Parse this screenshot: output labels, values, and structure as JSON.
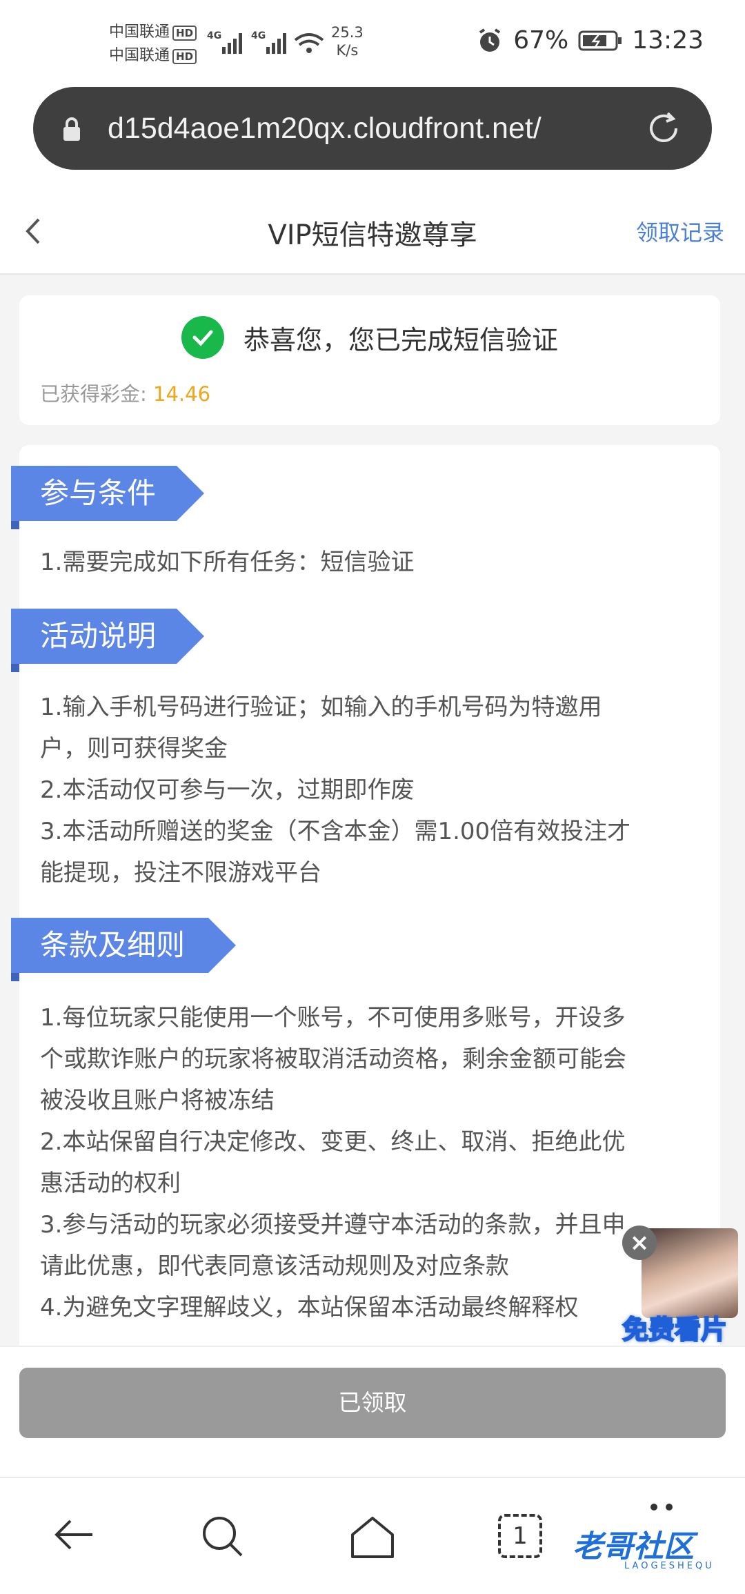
{
  "status_bar": {
    "carrier1": "中国联通",
    "carrier2": "中国联通",
    "hd": "HD",
    "net_type": "4G",
    "speed_value": "25.3",
    "speed_unit": "K/s",
    "battery": "67%",
    "time": "13:23"
  },
  "browser": {
    "url": "d15d4aoe1m20qx.cloudfront.net/",
    "tab_count": "1"
  },
  "header": {
    "title": "VIP短信特邀尊享",
    "records_link": "领取记录"
  },
  "success": {
    "message": "恭喜您，您已完成短信验证",
    "bonus_label": "已获得彩金:",
    "bonus_value": "14.46"
  },
  "sections": {
    "conditions": {
      "title": "参与条件",
      "items": [
        "1.需要完成如下所有任务：短信验证"
      ]
    },
    "description": {
      "title": "活动说明",
      "items": [
        "1.输入手机号码进行验证；如输入的手机号码为特邀用",
        "户，则可获得奖金",
        "2.本活动仅可参与一次，过期即作废",
        "3.本活动所赠送的奖金（不含本金）需1.00倍有效投注才",
        "能提现，投注不限游戏平台"
      ]
    },
    "terms": {
      "title": "条款及细则",
      "items": [
        "1.每位玩家只能使用一个账号，不可使用多账号，开设多",
        "个或欺诈账户的玩家将被取消活动资格，剩余金额可能会",
        "被没收且账户将被冻结",
        "2.本站保留自行决定修改、变更、终止、取消、拒绝此优",
        "惠活动的权利",
        "3.参与活动的玩家必须接受并遵守本活动的条款，并且申",
        "请此优惠，即代表同意该活动规则及对应条款",
        "4.为避免文字理解歧义，本站保留本活动最终解释权"
      ]
    }
  },
  "ad": {
    "close": "×",
    "label": "免费看片"
  },
  "claim_button": "已领取",
  "watermark": {
    "text": "老哥社区",
    "sub": "LAOGESHEQU"
  },
  "colors": {
    "accent": "#5b86e6",
    "link": "#4a7fd6",
    "success": "#18b84a",
    "bonus": "#f0a51a",
    "disabled_button": "#9a9a9a"
  }
}
